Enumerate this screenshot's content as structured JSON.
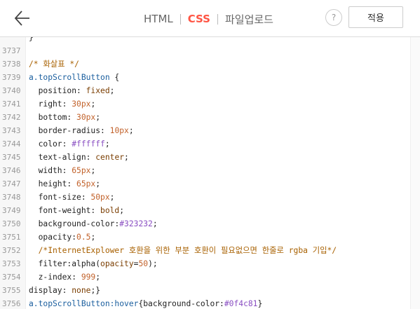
{
  "header": {
    "tabs": [
      {
        "label": "HTML",
        "active": false
      },
      {
        "label": "CSS",
        "active": true
      },
      {
        "label": "파일업로드",
        "active": false
      }
    ],
    "help_label": "?",
    "apply_label": "적용",
    "accent_color": "#ff5544"
  },
  "editor": {
    "lines": [
      {
        "num": "",
        "segments": [
          {
            "t": "}",
            "c": "prop"
          }
        ]
      },
      {
        "num": "3737",
        "segments": []
      },
      {
        "num": "3738",
        "segments": [
          {
            "t": "/* 화살표 */",
            "c": "comment"
          }
        ]
      },
      {
        "num": "3739",
        "segments": [
          {
            "t": "a.topScrollButton",
            "c": "selector"
          },
          {
            "t": " {",
            "c": "prop"
          }
        ]
      },
      {
        "num": "3740",
        "segments": [
          {
            "t": "  position",
            "c": "prop"
          },
          {
            "t": ": ",
            "c": "prop"
          },
          {
            "t": "fixed",
            "c": "value"
          },
          {
            "t": ";",
            "c": "prop"
          }
        ]
      },
      {
        "num": "3741",
        "segments": [
          {
            "t": "  right",
            "c": "prop"
          },
          {
            "t": ": ",
            "c": "prop"
          },
          {
            "t": "30px",
            "c": "num"
          },
          {
            "t": ";",
            "c": "prop"
          }
        ]
      },
      {
        "num": "3742",
        "segments": [
          {
            "t": "  bottom",
            "c": "prop"
          },
          {
            "t": ": ",
            "c": "prop"
          },
          {
            "t": "30px",
            "c": "num"
          },
          {
            "t": ";",
            "c": "prop"
          }
        ]
      },
      {
        "num": "3743",
        "segments": [
          {
            "t": "  border-radius",
            "c": "prop"
          },
          {
            "t": ": ",
            "c": "prop"
          },
          {
            "t": "10px",
            "c": "num"
          },
          {
            "t": ";",
            "c": "prop"
          }
        ]
      },
      {
        "num": "3744",
        "segments": [
          {
            "t": "  color",
            "c": "prop"
          },
          {
            "t": ": ",
            "c": "prop"
          },
          {
            "t": "#ffffff",
            "c": "color"
          },
          {
            "t": ";",
            "c": "prop"
          }
        ]
      },
      {
        "num": "3745",
        "segments": [
          {
            "t": "  text-align",
            "c": "prop"
          },
          {
            "t": ": ",
            "c": "prop"
          },
          {
            "t": "center",
            "c": "value"
          },
          {
            "t": ";",
            "c": "prop"
          }
        ]
      },
      {
        "num": "3746",
        "segments": [
          {
            "t": "  width",
            "c": "prop"
          },
          {
            "t": ": ",
            "c": "prop"
          },
          {
            "t": "65px",
            "c": "num"
          },
          {
            "t": ";",
            "c": "prop"
          }
        ]
      },
      {
        "num": "3747",
        "segments": [
          {
            "t": "  height",
            "c": "prop"
          },
          {
            "t": ": ",
            "c": "prop"
          },
          {
            "t": "65px",
            "c": "num"
          },
          {
            "t": ";",
            "c": "prop"
          }
        ]
      },
      {
        "num": "3748",
        "segments": [
          {
            "t": "  font-size",
            "c": "prop"
          },
          {
            "t": ": ",
            "c": "prop"
          },
          {
            "t": "50px",
            "c": "num"
          },
          {
            "t": ";",
            "c": "prop"
          }
        ]
      },
      {
        "num": "3749",
        "segments": [
          {
            "t": "  font-weight",
            "c": "prop"
          },
          {
            "t": ": ",
            "c": "prop"
          },
          {
            "t": "bold",
            "c": "value"
          },
          {
            "t": ";",
            "c": "prop"
          }
        ]
      },
      {
        "num": "3750",
        "segments": [
          {
            "t": "  background-color",
            "c": "prop"
          },
          {
            "t": ":",
            "c": "prop"
          },
          {
            "t": "#323232",
            "c": "color"
          },
          {
            "t": ";",
            "c": "prop"
          }
        ]
      },
      {
        "num": "3751",
        "segments": [
          {
            "t": "  opacity",
            "c": "prop"
          },
          {
            "t": ":",
            "c": "prop"
          },
          {
            "t": "0.5",
            "c": "num"
          },
          {
            "t": ";",
            "c": "prop"
          }
        ]
      },
      {
        "num": "3752",
        "segments": [
          {
            "t": "  /*InternetExplower 호환을 위한 부분 호환이 필요없으면 한줄로 rgba 기입*/",
            "c": "comment"
          }
        ]
      },
      {
        "num": "3753",
        "segments": [
          {
            "t": "  filter",
            "c": "prop"
          },
          {
            "t": ":alpha(",
            "c": "prop"
          },
          {
            "t": "opacity",
            "c": "value"
          },
          {
            "t": "=",
            "c": "prop"
          },
          {
            "t": "50",
            "c": "num"
          },
          {
            "t": ");",
            "c": "prop"
          }
        ]
      },
      {
        "num": "3754",
        "segments": [
          {
            "t": "  z-index",
            "c": "prop"
          },
          {
            "t": ": ",
            "c": "prop"
          },
          {
            "t": "999",
            "c": "num"
          },
          {
            "t": ";",
            "c": "prop"
          }
        ]
      },
      {
        "num": "3755",
        "segments": [
          {
            "t": "display",
            "c": "prop"
          },
          {
            "t": ": ",
            "c": "prop"
          },
          {
            "t": "none",
            "c": "value"
          },
          {
            "t": ";}",
            "c": "prop"
          }
        ]
      },
      {
        "num": "3756",
        "segments": [
          {
            "t": "a.topScrollButton",
            "c": "selector"
          },
          {
            "t": ":hover",
            "c": "selector"
          },
          {
            "t": "{background-color:",
            "c": "prop"
          },
          {
            "t": "#0f4c81",
            "c": "color"
          },
          {
            "t": "}",
            "c": "prop"
          }
        ]
      }
    ]
  }
}
